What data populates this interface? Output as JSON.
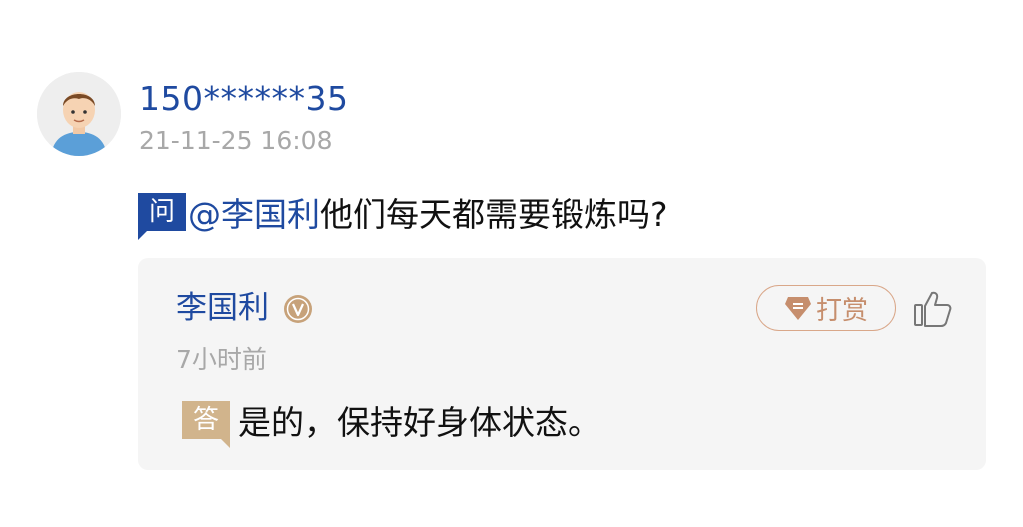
{
  "question": {
    "user": {
      "name": "150******35",
      "timestamp": "21-11-25 16:08",
      "avatar_icon": "user-avatar-icon"
    },
    "badge_label": "问",
    "mention": "@李国利",
    "text": "他们每天都需要锻炼吗?"
  },
  "answer": {
    "author_name": "李国利",
    "verified_icon": "verified-v-icon",
    "time_ago": "7小时前",
    "tip_label": "打赏",
    "badge_label": "答",
    "text": "是的，保持好身体状态。",
    "like_icon": "thumbs-up-icon"
  },
  "colors": {
    "brand_blue": "#1f4aa0",
    "answer_badge": "#d1b48c",
    "tip_accent": "#c68e6d",
    "card_bg": "#f5f5f5"
  }
}
